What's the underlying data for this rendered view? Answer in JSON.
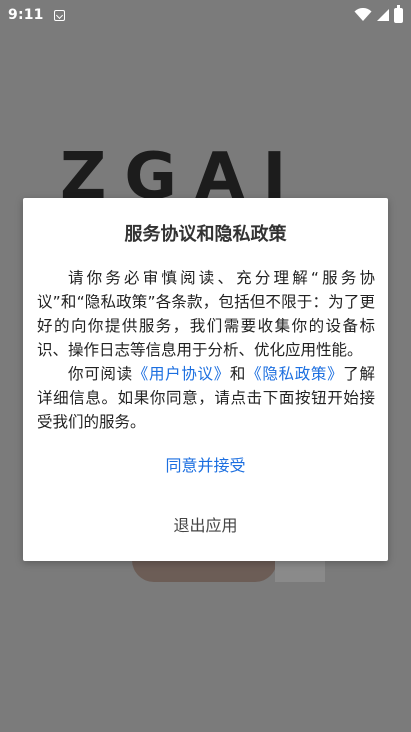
{
  "status_bar": {
    "time": "9:11",
    "icons": [
      "app-notification-icon",
      "wifi-icon",
      "signal-icon",
      "battery-icon"
    ]
  },
  "background": {
    "logo_text": "ZGAI"
  },
  "dialog": {
    "title": "服务协议和隐私政策",
    "paragraph1": "请你务必审慎阅读、充分理解“服务协议”和“隐私政策”各条款，包括但不限于：为了更好的向你提供服务，我们需要收集你的设备标识、操作日志等信息用于分析、优化应用性能。",
    "p2_prefix": "你可阅读",
    "user_agreement_link": "《用户协议》",
    "p2_and": "和",
    "privacy_policy_link": "《隐私政策》",
    "p2_suffix": "了解详细信息。如果你同意，请点击下面按钮开始接受我们的服务。",
    "agree_label": "同意并接受",
    "exit_label": "退出应用"
  },
  "colors": {
    "accent": "#1c6fe0",
    "overlay": "#7b7b7b"
  }
}
